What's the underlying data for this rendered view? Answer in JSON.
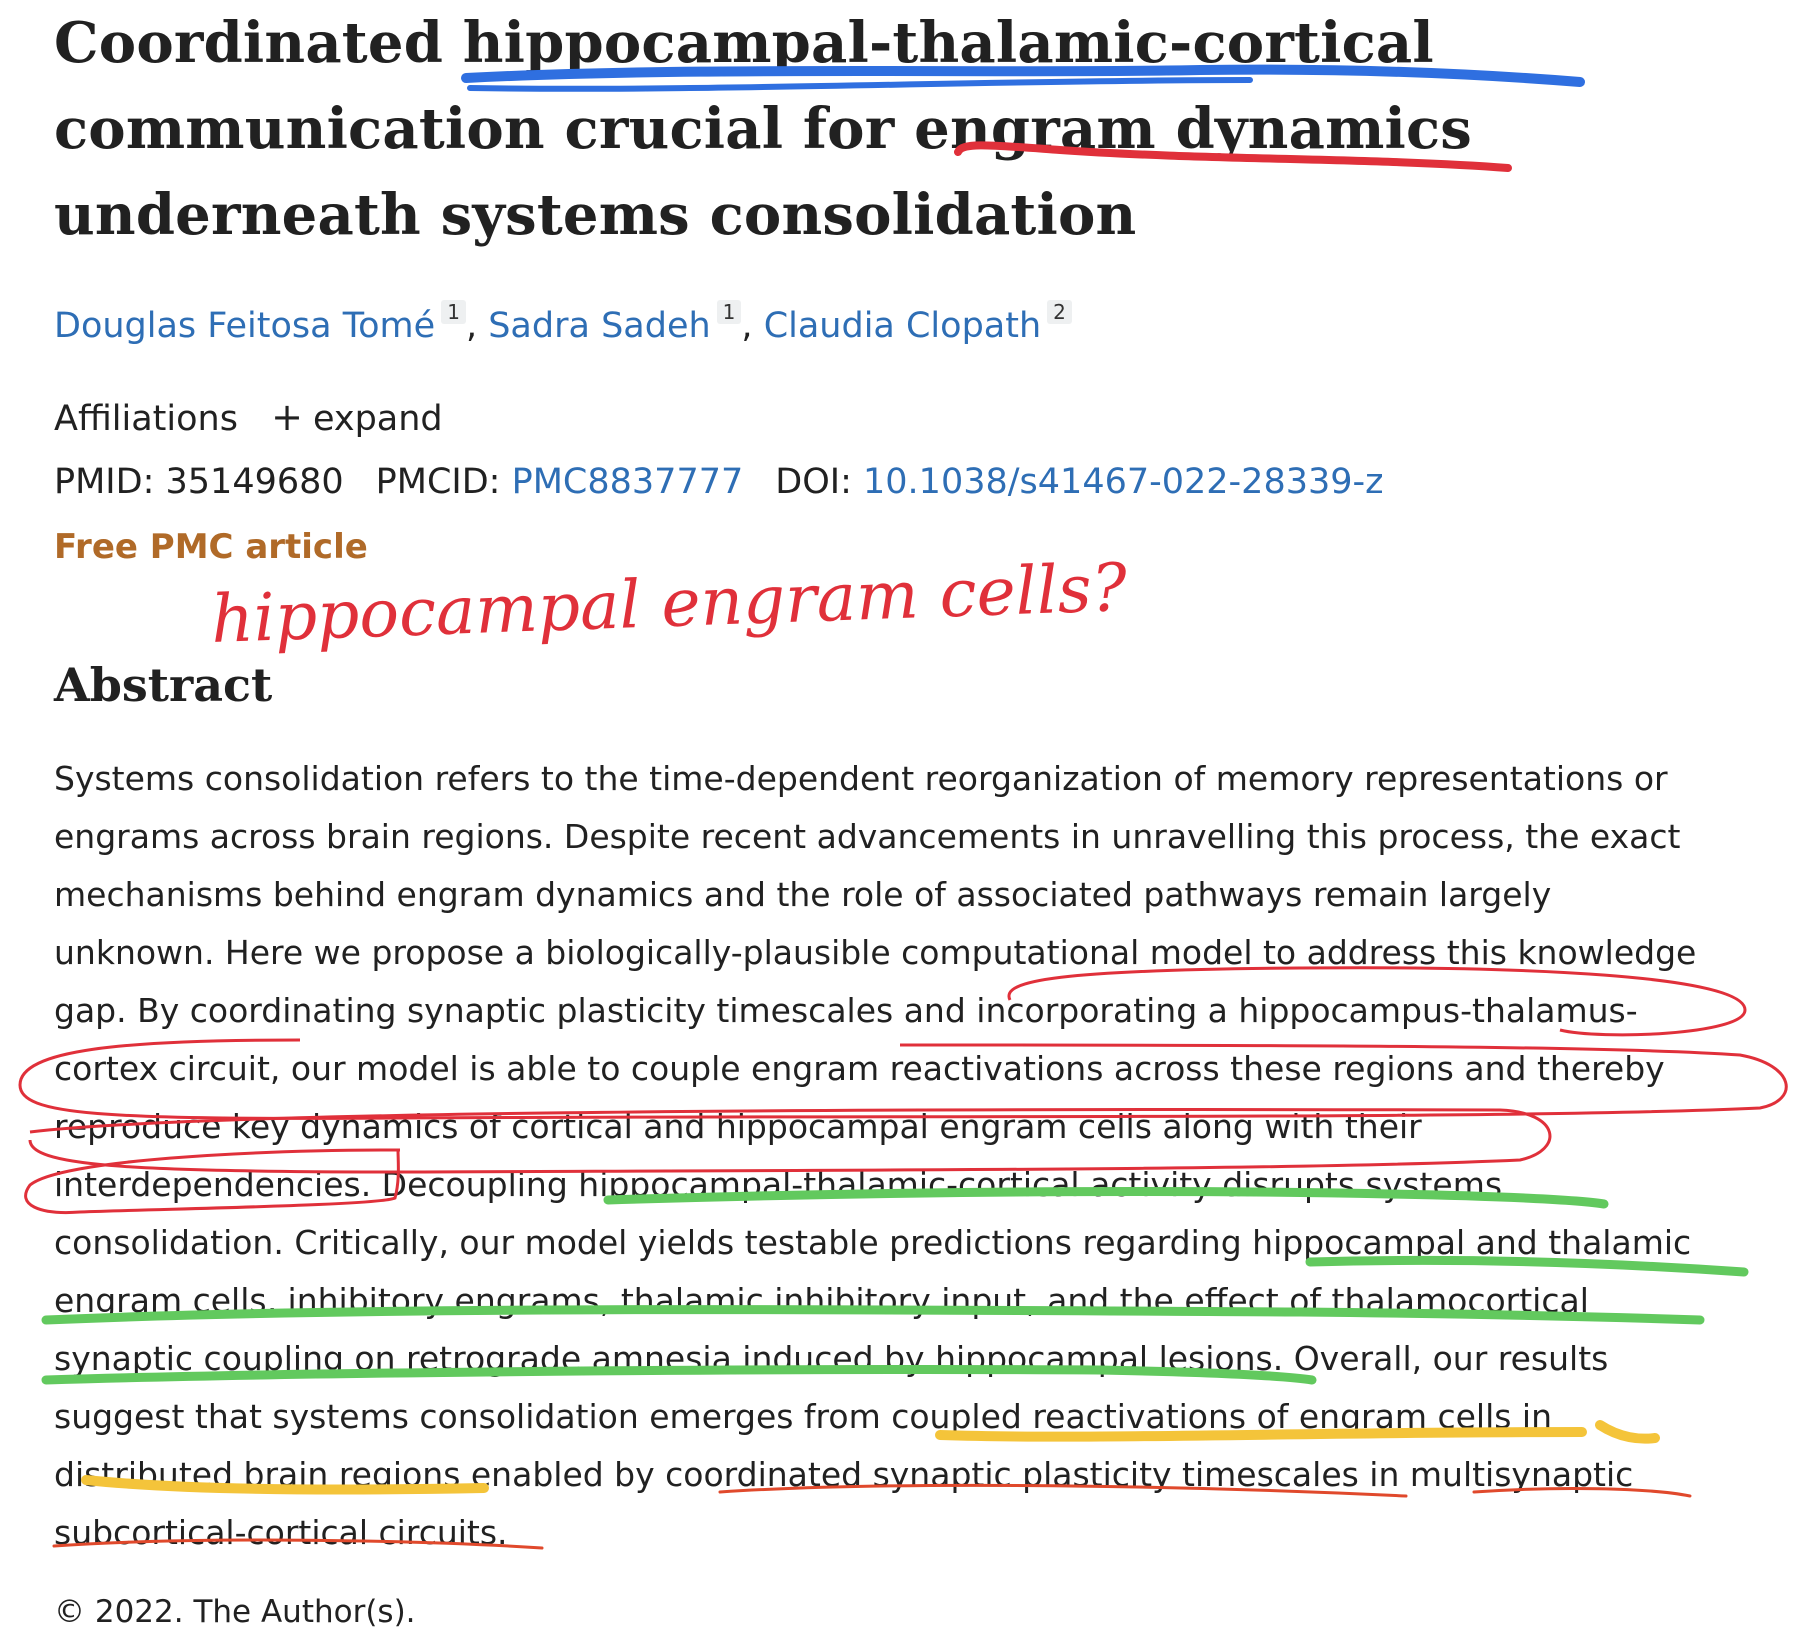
{
  "title": {
    "lines": [
      "Coordinated hippocampal-thalamic-cortical",
      "communication crucial for engram dynamics",
      "underneath systems consolidation"
    ]
  },
  "authors": [
    {
      "name": "Douglas Feitosa Tomé",
      "affiliation": "1"
    },
    {
      "name": "Sadra Sadeh",
      "affiliation": "1"
    },
    {
      "name": "Claudia Clopath",
      "affiliation": "2"
    }
  ],
  "author_separator": ",",
  "affiliations": {
    "label": "Affiliations",
    "expand_icon": "+",
    "expand_label": "expand"
  },
  "ids": {
    "pmid_label": "PMID:",
    "pmid": "35149680",
    "pmcid_label": "PMCID:",
    "pmcid": "PMC8837777",
    "doi_label": "DOI:",
    "doi": "10.1038/s41467-022-28339-z"
  },
  "free_article": "Free PMC article",
  "handwritten_note": "hippocampal engram cells?",
  "abstract": {
    "heading": "Abstract",
    "lines": [
      "Systems consolidation refers to the time-dependent reorganization of memory representations or",
      "engrams across brain regions. Despite recent advancements in unravelling this process, the exact",
      "mechanisms behind engram dynamics and the role of associated pathways remain largely",
      "unknown. Here we propose a biologically-plausible computational model to address this knowledge",
      "gap. By coordinating synaptic plasticity timescales and incorporating a hippocampus-thalamus-",
      "cortex circuit, our model is able to couple engram reactivations across these regions and thereby",
      "reproduce key dynamics of cortical and hippocampal engram cells along with their",
      "interdependencies. Decoupling hippocampal-thalamic-cortical activity disrupts systems",
      "consolidation. Critically, our model yields testable predictions regarding hippocampal and thalamic",
      "engram cells, inhibitory engrams, thalamic inhibitory input, and the effect of thalamocortical",
      "synaptic coupling on retrograde amnesia induced by hippocampal lesions. Overall, our results",
      "suggest that systems consolidation emerges from coupled reactivations of engram cells in",
      "distributed brain regions enabled by coordinated synaptic plasticity timescales in multisynaptic",
      "subcortical-cortical circuits."
    ]
  },
  "copyright": "© 2022. The Author(s).",
  "annotation_colors": {
    "blue": "#2f6fe0",
    "red": "#e0303a",
    "green": "#62c95e",
    "yellow": "#f4c43a",
    "orange_red": "#e0492c"
  }
}
